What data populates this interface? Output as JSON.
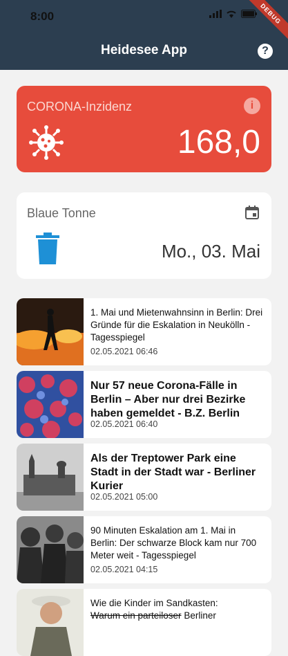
{
  "status_bar": {
    "time": "8:00"
  },
  "app": {
    "title": "Heidesee App",
    "debug_label": "DEBUG"
  },
  "corona": {
    "label": "CORONA-Inzidenz",
    "value": "168,0"
  },
  "trash": {
    "label": "Blaue Tonne",
    "date": "Mo., 03. Mai"
  },
  "news": [
    {
      "title": "1. Mai und Mietenwahnsinn in Berlin: Drei Gründe für die Eskalation in Neukölln - Tagesspiegel",
      "date": "02.05.2021 06:46"
    },
    {
      "title": "Nur 57 neue Corona-Fälle in Berlin – Aber nur drei Bezirke haben gemeldet - B.Z. Berlin",
      "date": "02.05.2021 06:40"
    },
    {
      "title": "Als der Treptower Park eine Stadt in der Stadt war - Berliner Kurier",
      "date": "02.05.2021 05:00"
    },
    {
      "title": "90 Minuten Eskalation am 1. Mai in Berlin: Der schwarze Block kam nur 700 Meter weit - Tagesspiegel",
      "date": "02.05.2021 04:15"
    },
    {
      "title_pre": "Wie die Kinder im Sandkasten:",
      "title_struck": "Warum ein parteiloser",
      "title_post": "Berliner"
    }
  ],
  "colors": {
    "header": "#2c3e50",
    "corona_card": "#e74c3c",
    "bin_blue": "#1e90d6"
  }
}
